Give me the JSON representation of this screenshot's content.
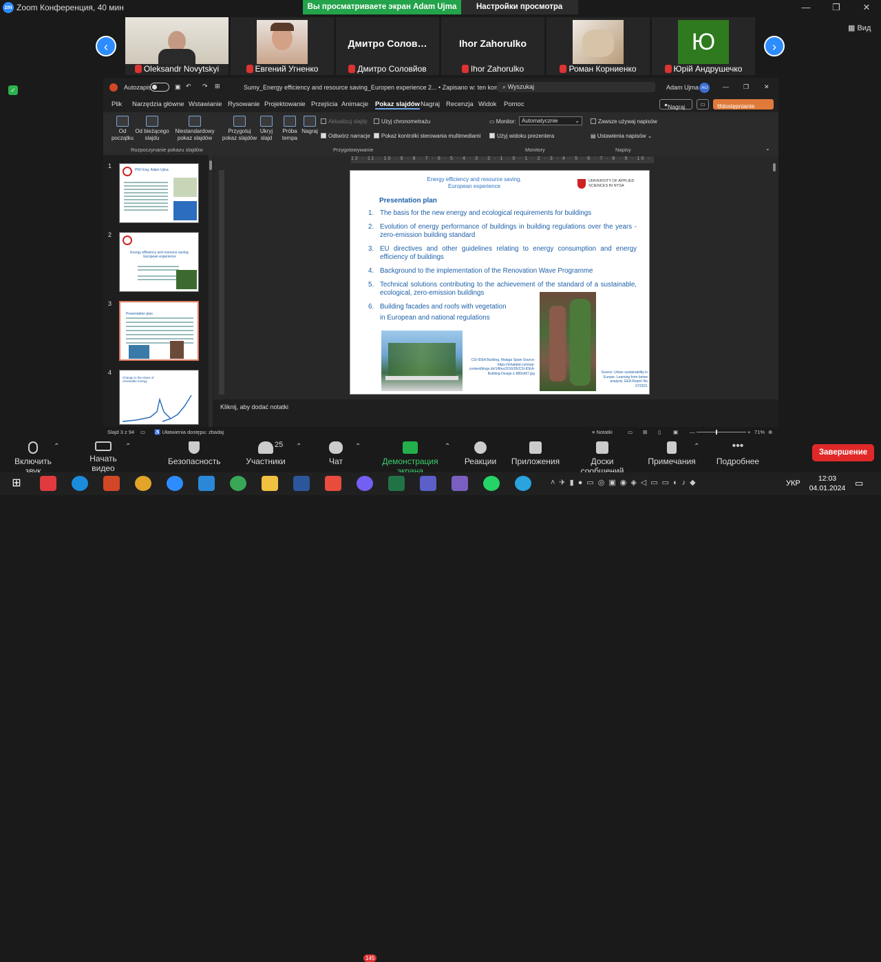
{
  "zoom": {
    "title": "Zoom Конференция, 40 мин",
    "share_banner": "Вы просматриваете экран Adam Ujma",
    "view_options": "Настройки просмотра",
    "view_label": "Вид"
  },
  "participants": [
    {
      "name": "Oleksandr Novytskyi",
      "display": ""
    },
    {
      "name": "Евгений Угненко",
      "display": ""
    },
    {
      "name": "Дмитро Соловйов",
      "display": "Дмитро  Солов…"
    },
    {
      "name": "Ihor Zahorulko",
      "display": "Ihor Zahorulko"
    },
    {
      "name": "Роман Корниенко",
      "display": ""
    },
    {
      "name": "Юрій Андрушечко",
      "display": "Ю"
    }
  ],
  "ppt": {
    "autosave": "Autozapis",
    "filename": "Sumy_Energy efficiency and resource saving_Europen experience 2... • Zapisano w: ten komputer",
    "search": "Wyszukaj",
    "user": "Adam Ujma",
    "user_initials": "AU",
    "menu": [
      "Plik",
      "Narzędzia główne",
      "Wstawianie",
      "Rysowanie",
      "Projektowanie",
      "Przejścia",
      "Animacje",
      "Pokaz slajdów",
      "Nagraj",
      "Recenzja",
      "Widok",
      "Pomoc"
    ],
    "record_btn": "Nagraj",
    "share_btn": "Udostępnianie",
    "ribbon": {
      "from_start": "Od początku",
      "from_current": "Od bieżącego slajdu",
      "custom": "Niestandardowy pokaz slajdów",
      "group1": "Rozpoczynanie pokazu slajdów",
      "setup": "Przygotuj pokaz slajdów",
      "hide": "Ukryj slajd",
      "rehearse": "Próba tempa",
      "record": "Nagraj",
      "update_slides": "Aktualizuj slajdy",
      "use_timings": "Użyj chronometrażu",
      "play_narration": "Odtwórz narracje",
      "show_media": "Pokaż kontrolki sterowania multimediami",
      "group2": "Przygotowywanie",
      "monitor_label": "Monitor:",
      "monitor_value": "Automatycznie",
      "presenter_view": "Użyj widoku prezentera",
      "group3": "Monitory",
      "always_subtitles": "Zawsze używaj napisów",
      "subtitle_settings": "Ustawienia napisów",
      "group4": "Napisy"
    },
    "thumb_numbers": [
      "1",
      "2",
      "3",
      "4"
    ],
    "thumb_texts": [
      "PhD Eng. Adam Ujma",
      "Energy efficiency and resource saving. European experience",
      "Presentation plan",
      "Change in the share of renewable energy"
    ],
    "ruler": "12 · 11 · 10 · 9 · 8 · 7 · 6 · 5 · 4 · 3 · 2 · 1 · 0 · 1 · 2 · 3 · 4 · 5 · 6 · 7 · 8 · 9 · 10 · 11 · 12",
    "notes": "Kliknij, aby dodać notatki",
    "status_slide": "Slajd 3 z 94",
    "status_access": "Ułatwienia dostępu: zbadaj",
    "status_notes": "Notatki",
    "zoom_pct": "71%"
  },
  "slide": {
    "header1": "Energy efficiency and resource saving.",
    "header2": "European experience",
    "uni": "UNIVERSITY OF APPLIED SCIENCES IN NYSA",
    "title": "Presentation plan",
    "items": [
      "The basis for the new energy and ecological requirements for buildings",
      "Evolution of energy performance of buildings in building regulations over the years - zero-emission building standard",
      "EU directives and other guidelines relating to energy consumption and energy efficiency of buildings",
      "Background to the implementation of the Renovation Wave Programme",
      "Technical solutions contributing to the achievement of the standard of a sustainable, ecological, zero-emission buildings",
      "Building facades and roofs with vegetation",
      "in European and national regulations"
    ],
    "caption1": "CSI-IDEA Building, Malaga Spain Source: https://inhabitat.com/wp-content/blogs.dir/1/files/2016/05/CSI-IDEA-Building-Design-1-889x667.jpg",
    "caption2": "Source: Urban sustainability in Europe. Learning from below analysis. EEA Report No 07/2021"
  },
  "controls": [
    "Включить звук",
    "Начать видео",
    "Безопасность",
    "Участники",
    "Чат",
    "Демонстрация экрана",
    "Реакции",
    "Приложения",
    "Доски сообщений",
    "Примечания",
    "Подробнее"
  ],
  "participants_count": "25",
  "end_button": "Завершение",
  "taskbar": {
    "lang": "УКР",
    "time": "12:03",
    "date": "04.01.2024",
    "badge": "145"
  }
}
